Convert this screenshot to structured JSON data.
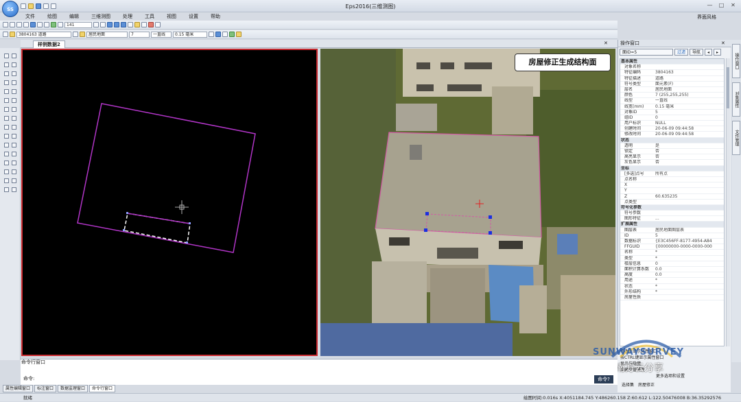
{
  "app": {
    "title": "Eps2016(三维测图)",
    "logo_text": "SS",
    "layout_label": "界面风格",
    "window_controls": [
      "—",
      "□",
      "✕"
    ]
  },
  "menu": [
    "文件",
    "绘图",
    "编辑",
    "三维测图",
    "处理",
    "工具",
    "视图",
    "设置",
    "帮助"
  ],
  "toolbar": {
    "zoom_value": "141",
    "code_select": "3804163 道路",
    "layer_select": "居民地面",
    "color_value": "7",
    "linetype": "一直线",
    "linewidth": "0.15 毫米"
  },
  "doc_tab": "样例数据2",
  "photo_callout": "房屋修正生成结构面",
  "right_panel": {
    "title": "操作窗口",
    "object_select": "面ID=5",
    "btn_filter": "过滤",
    "btn_nav": "导航",
    "properties": [
      {
        "section": true,
        "k": "基本属性",
        "v": ""
      },
      {
        "k": "对象名称",
        "v": ""
      },
      {
        "k": "特征编码",
        "v": "3804163"
      },
      {
        "k": "特征描述",
        "v": "道路"
      },
      {
        "k": "符号类型",
        "v": "面元素(F)"
      },
      {
        "k": "层名",
        "v": "居民地面"
      },
      {
        "k": "颜色",
        "v": "7 (255,255,255)"
      },
      {
        "k": "线型",
        "v": "一直线"
      },
      {
        "k": "线宽(mm)",
        "v": "0.15 毫米"
      },
      {
        "k": "对象ID",
        "v": "5"
      },
      {
        "k": "组ID",
        "v": "0"
      },
      {
        "k": "用户标识",
        "v": "NULL"
      },
      {
        "k": "创建时间",
        "v": "20-06-09 09:44:58"
      },
      {
        "k": "修改时间",
        "v": "20-06-09 09:44:58"
      },
      {
        "section": true,
        "k": "状态",
        "v": ""
      },
      {
        "k": "透明",
        "v": "是"
      },
      {
        "k": "锁定",
        "v": "否"
      },
      {
        "k": "高亮显示",
        "v": "否"
      },
      {
        "k": "灰色显示",
        "v": "否"
      },
      {
        "section": true,
        "k": "坐标",
        "v": ""
      },
      {
        "k": "[多选]点号",
        "v": "所有点"
      },
      {
        "k": "点名称",
        "v": ""
      },
      {
        "k": "X",
        "v": ""
      },
      {
        "k": "Y",
        "v": ""
      },
      {
        "k": "Z",
        "v": "60.635235"
      },
      {
        "k": "点类型",
        "v": ""
      },
      {
        "section": true,
        "k": "符号化参数",
        "v": ""
      },
      {
        "k": "符号参数",
        "v": ""
      },
      {
        "k": "图形特征",
        "v": "..."
      },
      {
        "section": true,
        "k": "扩展属性",
        "v": ""
      },
      {
        "k": "图层表",
        "v": "居民地面图层表"
      },
      {
        "k": "ID",
        "v": "5"
      },
      {
        "k": "数据标识",
        "v": "{E3C456FF-8177-4954-A84"
      },
      {
        "k": "FFGUID",
        "v": "{00000000-0000-0000-000"
      },
      {
        "k": "名称",
        "v": "*"
      },
      {
        "k": "类型",
        "v": "*"
      },
      {
        "k": "楼层信息",
        "v": "0"
      },
      {
        "k": "面积计算系数",
        "v": "0.0"
      },
      {
        "k": "高度",
        "v": "0.0"
      },
      {
        "k": "用途",
        "v": "*"
      },
      {
        "k": "状态",
        "v": "*"
      },
      {
        "k": "外形结构",
        "v": "*"
      },
      {
        "k": "房屋性质",
        "v": ""
      }
    ],
    "side_tabs": [
      "操作窗口",
      "对象属性",
      "文件管理"
    ],
    "bottom_checks": [
      "修改后显示属性窗口",
      "按CTRL键显示属性窗口",
      "显示与隐藏",
      "隐藏空值属性"
    ],
    "bottom_link": "更多选项和设置",
    "bottom_tabs": [
      "选择集",
      "房屋修正"
    ]
  },
  "command": {
    "title": "命令行窗口",
    "prompt": "命令:",
    "button": "命令?",
    "tabs": [
      "属性编辑窗口",
      "标注窗口",
      "数据监理窗口",
      "命令行窗口"
    ]
  },
  "status": {
    "left": "就绪",
    "right": "绘图时间:0.016s  X:4051184.745  Y:486260.158  Z:60.612  L:122.50476008  B:36.35292576"
  },
  "watermark": {
    "brand": "SUNWAYSURVEY",
    "caption": "南方云分享"
  }
}
